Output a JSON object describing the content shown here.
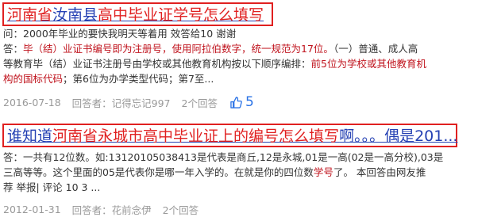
{
  "result1": {
    "title_parts": [
      "河南省",
      "汝南县",
      "高中毕业证学号怎么填写"
    ],
    "question": "问：2000年毕业的要快我明天等着用 效答给10 谢谢",
    "answer_label": "答：",
    "answer_red1": "毕（结）业证书编号即为注册号，使用阿拉伯数字，统一规范为17位。",
    "answer_plain1": "（一）普通、成人高",
    "answer_line2_plain": "等教育毕（结）业证书注册号由学校或其他教育机构按以下顺序编排：",
    "answer_line2_red": "前5位为学校或其他教育机",
    "answer_line3_red": "构的国标代码",
    "answer_line3_plain": "；第6位为办学类型代码；第7至...",
    "date": "2016-07-18",
    "answerer": "回答者：记得忘记997",
    "answer_count": "2个回答",
    "likes": "5"
  },
  "result2": {
    "title_parts": [
      "谁知道",
      "河南省永城市",
      "高中毕业证上的编号",
      "怎么填写",
      "啊。。。偶是201..."
    ],
    "line1": "答：一共有12位数。如:13120105038413是代表是商丘,12是永城,01是一高(02是一高分校),03是",
    "line2_plain": "三高等等。这个里面的05是代表你是哪一年入学的。在就是你的四位数",
    "line2_red": "学号",
    "line2_end": "了。 本回答由网友推",
    "line3": "荐 举报| 评论 10 3 ...",
    "date": "2012-01-31",
    "answerer": "回答者：花前念伊",
    "answer_count": "2个回答"
  },
  "colors": {
    "title": "#2440b3",
    "highlight": "#e02020",
    "meta": "#999999",
    "like": "#2b73e6"
  },
  "icons": {
    "like": "thumbs-up-icon"
  }
}
